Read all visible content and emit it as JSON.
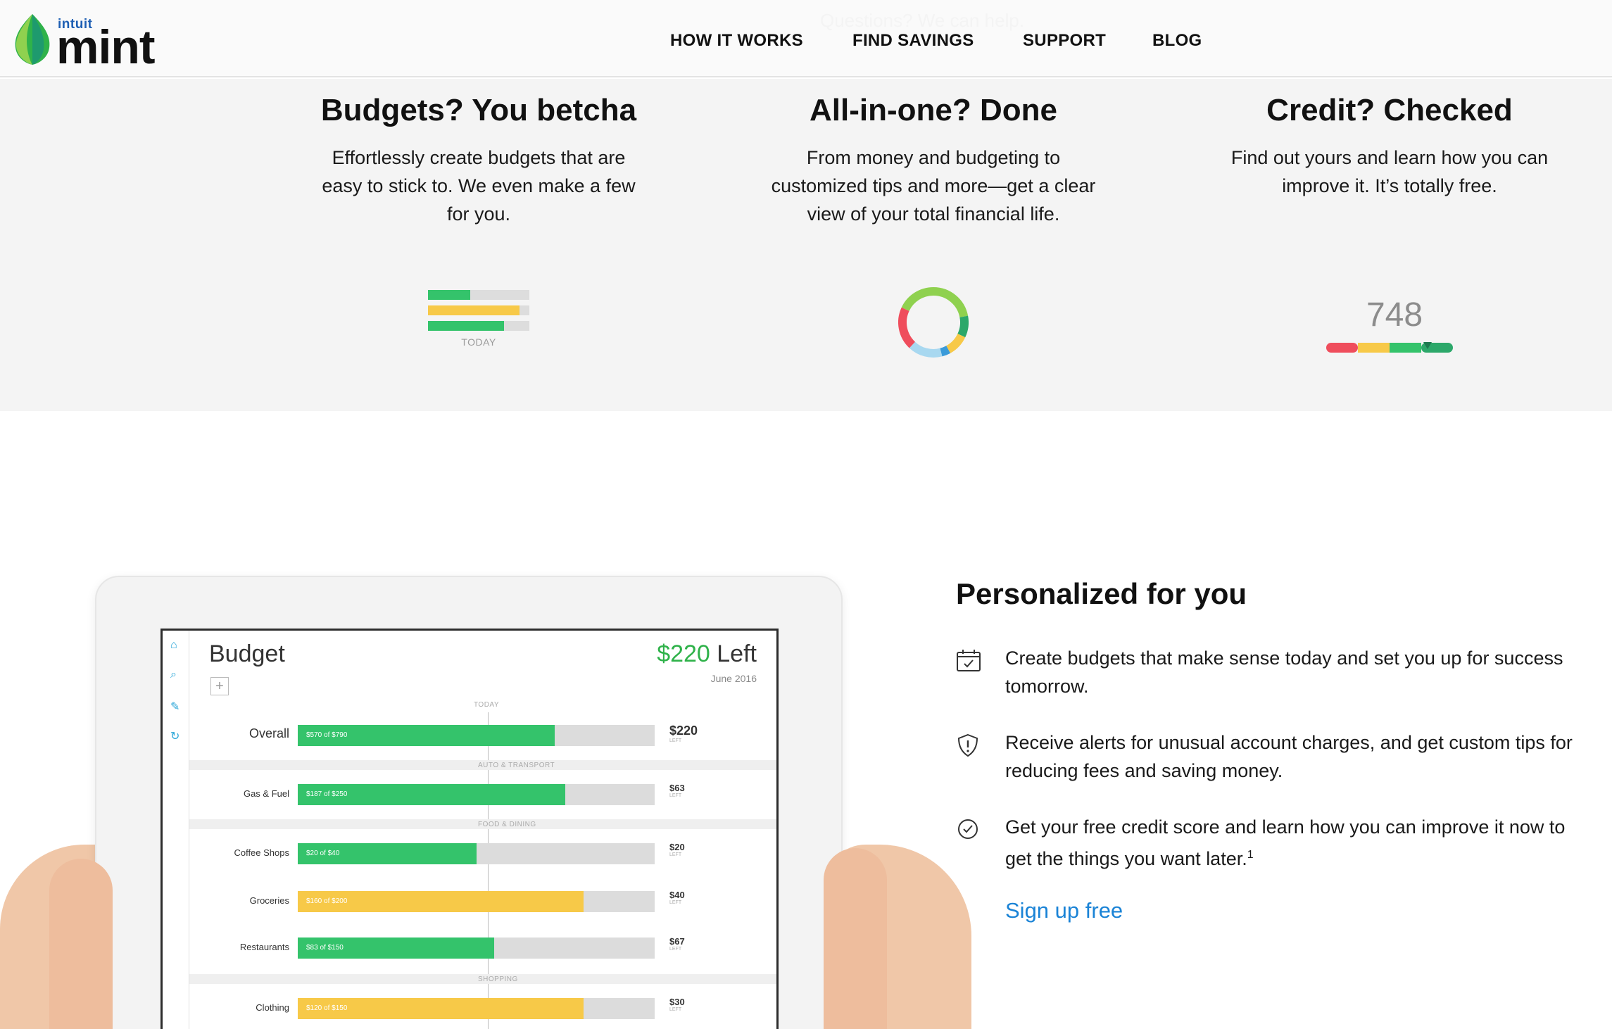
{
  "header": {
    "logo_brand_small": "intuit",
    "logo_brand": "mint",
    "ghost_text": "Questions? We can help.",
    "nav": [
      {
        "label": "HOW IT WORKS"
      },
      {
        "label": "FIND SAVINGS"
      },
      {
        "label": "SUPPORT"
      },
      {
        "label": "BLOG"
      }
    ]
  },
  "features": [
    {
      "title": "Budgets? You betcha",
      "text": "Effortlessly create budgets that are easy to stick to. We even make a few for you."
    },
    {
      "title": "All-in-one? Done",
      "text": "From money and budgeting to customized tips and more—get a clear view of your total financial life."
    },
    {
      "title": "Credit? Checked",
      "text": "Find out yours and learn how you can improve it. It’s totally free."
    }
  ],
  "mini_budget": {
    "label": "TODAY",
    "bars": [
      {
        "fraction": 0.42,
        "color": "#34c36b"
      },
      {
        "fraction": 0.9,
        "color": "#f7c948"
      },
      {
        "fraction": 0.75,
        "color": "#34c36b"
      }
    ]
  },
  "donut": {
    "segments": [
      {
        "value": 22,
        "color": "#8fd14f"
      },
      {
        "value": 10,
        "color": "#2ca86a"
      },
      {
        "value": 10,
        "color": "#f7c948"
      },
      {
        "value": 4,
        "color": "#3a9ad9"
      },
      {
        "value": 16,
        "color": "#a8d8f0"
      },
      {
        "value": 20,
        "color": "#ef4d5c"
      },
      {
        "value": 18,
        "color": "#8fd14f"
      }
    ]
  },
  "credit": {
    "score": "748",
    "colors": [
      "#ef4d5c",
      "#f7c948",
      "#34c36b",
      "#2ca86a"
    ]
  },
  "tablet": {
    "title": "Budget",
    "left_amount": "$220",
    "left_label": " Left",
    "date": "June 2016",
    "today_label": "TODAY",
    "rows": [
      {
        "label": "Overall",
        "text": "$570 of $790",
        "fraction": 0.72,
        "color": "#34c36b",
        "amount": "$220",
        "sub": "LEFT",
        "section": ""
      },
      {
        "label": "Gas & Fuel",
        "text": "$187 of $250",
        "fraction": 0.75,
        "color": "#34c36b",
        "amount": "$63",
        "sub": "LEFT",
        "section": "AUTO & TRANSPORT"
      },
      {
        "label": "Coffee Shops",
        "text": "$20 of $40",
        "fraction": 0.5,
        "color": "#34c36b",
        "amount": "$20",
        "sub": "LEFT",
        "section": "FOOD & DINING"
      },
      {
        "label": "Groceries",
        "text": "$160 of $200",
        "fraction": 0.8,
        "color": "#f7c948",
        "amount": "$40",
        "sub": "LEFT",
        "section": ""
      },
      {
        "label": "Restaurants",
        "text": "$83 of $150",
        "fraction": 0.55,
        "color": "#34c36b",
        "amount": "$67",
        "sub": "LEFT",
        "section": ""
      },
      {
        "label": "Clothing",
        "text": "$120 of $150",
        "fraction": 0.8,
        "color": "#f7c948",
        "amount": "$30",
        "sub": "LEFT",
        "section": "SHOPPING"
      }
    ]
  },
  "personal": {
    "title": "Personalized for you",
    "items": [
      {
        "icon": "calendar-check-icon",
        "text": "Create budgets that make sense today and set you up for success tomorrow."
      },
      {
        "icon": "shield-alert-icon",
        "text": "Receive alerts for unusual account charges, and get custom tips for reducing fees and saving money."
      },
      {
        "icon": "check-circle-icon",
        "text": "Get your free credit score and learn how you can improve it now to get the things you want later.",
        "sup": "1"
      }
    ],
    "cta": "Sign up free"
  }
}
